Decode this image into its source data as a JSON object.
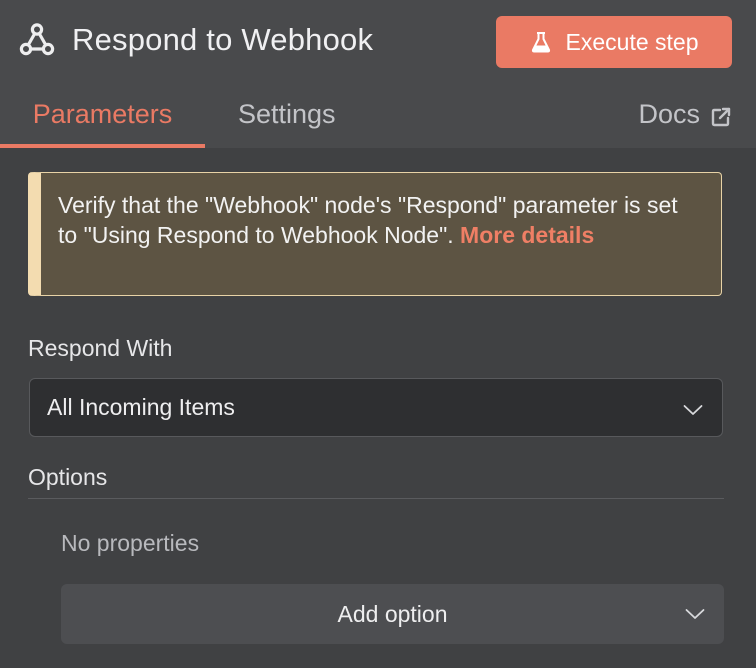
{
  "header": {
    "node_icon": "webhook-icon",
    "title": "Respond to Webhook",
    "execute_button": {
      "icon": "flask-icon",
      "label": "Execute step"
    }
  },
  "tabs": [
    {
      "label": "Parameters",
      "active": true
    },
    {
      "label": "Settings",
      "active": false
    }
  ],
  "docs_link": {
    "label": "Docs",
    "icon": "external-link-icon"
  },
  "notice": {
    "text": "Verify that the \"Webhook\" node's \"Respond\" parameter is set to \"Using Respond to Webhook Node\". ",
    "link_label": "More details"
  },
  "respond_with": {
    "label": "Respond With",
    "value": "All Incoming Items",
    "icon": "chevron-down-icon"
  },
  "options": {
    "label": "Options",
    "empty_text": "No properties",
    "add_button_label": "Add option",
    "icon": "chevron-down-icon"
  },
  "colors": {
    "accent": "#ea7a64",
    "background": "#404143",
    "header_background": "#494a4c",
    "notice_background": "#5d5443",
    "notice_border": "#f3dcb0"
  }
}
